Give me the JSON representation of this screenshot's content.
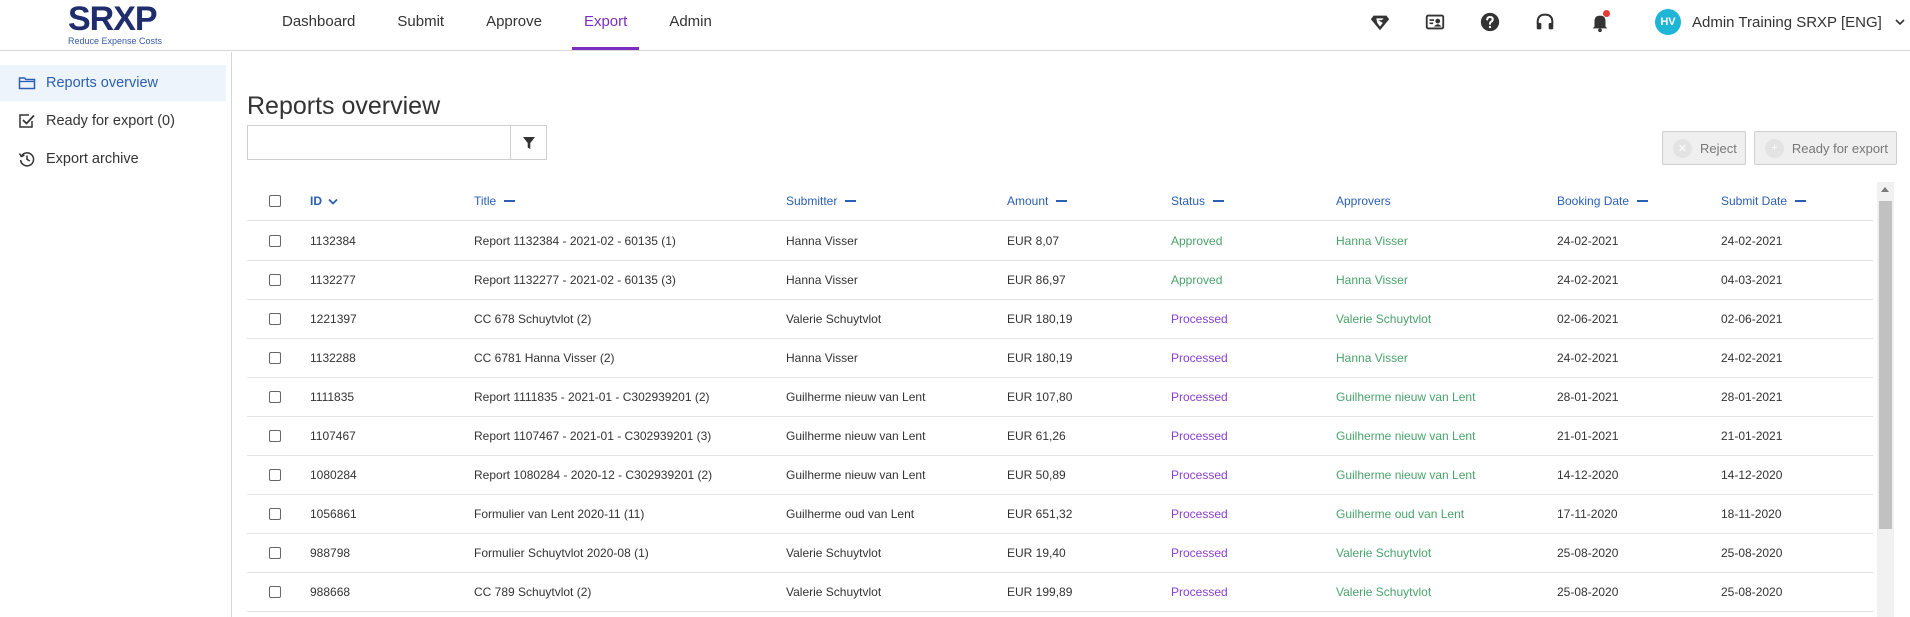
{
  "brand": {
    "name_left": "SR",
    "name_x": "X",
    "name_right": "P",
    "tagline": "Reduce Expense Costs"
  },
  "nav": {
    "items": [
      {
        "label": "Dashboard",
        "active": false
      },
      {
        "label": "Submit",
        "active": false
      },
      {
        "label": "Approve",
        "active": false
      },
      {
        "label": "Export",
        "active": true
      },
      {
        "label": "Admin",
        "active": false
      }
    ]
  },
  "topbar_icons": [
    "superman-icon",
    "id-card-icon",
    "help-icon",
    "headset-icon",
    "bell-icon"
  ],
  "user": {
    "initials": "HV",
    "name": "Admin Training SRXP [ENG]"
  },
  "sidebar": {
    "items": [
      {
        "label": "Reports overview",
        "icon": "folder-icon",
        "active": true
      },
      {
        "label": "Ready for export (0)",
        "icon": "checkbox-icon",
        "active": false
      },
      {
        "label": "Export archive",
        "icon": "history-icon",
        "active": false
      }
    ]
  },
  "main": {
    "title": "Reports overview",
    "search": {
      "value": "",
      "placeholder": ""
    },
    "reject_label": "Reject",
    "ready_label": "Ready for export"
  },
  "table": {
    "columns": [
      "ID",
      "Title",
      "Submitter",
      "Amount",
      "Status",
      "Approvers",
      "Booking Date",
      "Submit Date"
    ],
    "rows": [
      {
        "id": "1132384",
        "title": "Report 1132384 - 2021-02 - 60135 (1)",
        "submitter": "Hanna Visser",
        "amount": "EUR 8,07",
        "status": "Approved",
        "approvers": "Hanna Visser",
        "booking_date": "24-02-2021",
        "submit_date": "24-02-2021"
      },
      {
        "id": "1132277",
        "title": "Report 1132277 - 2021-02 - 60135 (3)",
        "submitter": "Hanna Visser",
        "amount": "EUR 86,97",
        "status": "Approved",
        "approvers": "Hanna Visser",
        "booking_date": "24-02-2021",
        "submit_date": "04-03-2021"
      },
      {
        "id": "1221397",
        "title": "CC 678 Schuytvlot (2)",
        "submitter": "Valerie Schuytvlot",
        "amount": "EUR 180,19",
        "status": "Processed",
        "approvers": "Valerie Schuytvlot",
        "booking_date": "02-06-2021",
        "submit_date": "02-06-2021"
      },
      {
        "id": "1132288",
        "title": "CC 6781 Hanna Visser (2)",
        "submitter": "Hanna Visser",
        "amount": "EUR 180,19",
        "status": "Processed",
        "approvers": "Hanna Visser",
        "booking_date": "24-02-2021",
        "submit_date": "24-02-2021"
      },
      {
        "id": "1111835",
        "title": "Report 1111835 - 2021-01 - C302939201 (2)",
        "submitter": "Guilherme nieuw van Lent",
        "amount": "EUR 107,80",
        "status": "Processed",
        "approvers": "Guilherme nieuw van Lent",
        "booking_date": "28-01-2021",
        "submit_date": "28-01-2021"
      },
      {
        "id": "1107467",
        "title": "Report 1107467 - 2021-01 - C302939201 (3)",
        "submitter": "Guilherme nieuw van Lent",
        "amount": "EUR 61,26",
        "status": "Processed",
        "approvers": "Guilherme nieuw van Lent",
        "booking_date": "21-01-2021",
        "submit_date": "21-01-2021"
      },
      {
        "id": "1080284",
        "title": "Report 1080284 - 2020-12 - C302939201 (2)",
        "submitter": "Guilherme nieuw van Lent",
        "amount": "EUR 50,89",
        "status": "Processed",
        "approvers": "Guilherme nieuw van Lent",
        "booking_date": "14-12-2020",
        "submit_date": "14-12-2020"
      },
      {
        "id": "1056861",
        "title": "Formulier van Lent 2020-11 (11)",
        "submitter": "Guilherme oud van Lent",
        "amount": "EUR 651,32",
        "status": "Processed",
        "approvers": "Guilherme oud van Lent",
        "booking_date": "17-11-2020",
        "submit_date": "18-11-2020"
      },
      {
        "id": "988798",
        "title": "Formulier Schuytvlot 2020-08 (1)",
        "submitter": "Valerie Schuytvlot",
        "amount": "EUR 19,40",
        "status": "Processed",
        "approvers": "Valerie Schuytvlot",
        "booking_date": "25-08-2020",
        "submit_date": "25-08-2020"
      },
      {
        "id": "988668",
        "title": "CC 789 Schuytvlot (2)",
        "submitter": "Valerie Schuytvlot",
        "amount": "EUR 199,89",
        "status": "Processed",
        "approvers": "Valerie Schuytvlot",
        "booking_date": "25-08-2020",
        "submit_date": "25-08-2020"
      }
    ]
  },
  "colors": {
    "accent": "#7b2fbe",
    "link": "#2a5fb3",
    "approved": "#4aa36c",
    "processed": "#8a3fd0",
    "avatar": "#1fb5d6"
  }
}
